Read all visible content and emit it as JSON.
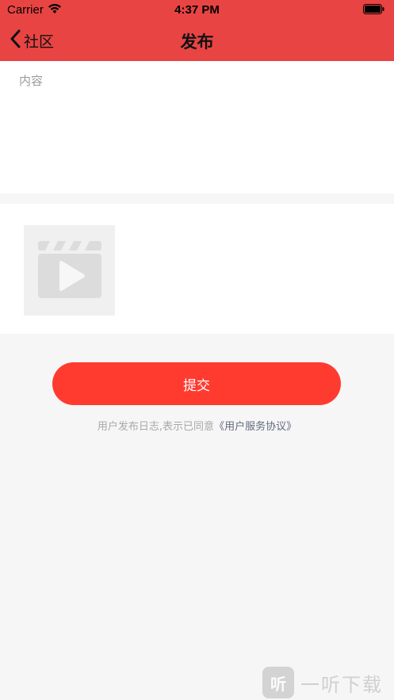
{
  "status_bar": {
    "carrier": "Carrier",
    "time": "4:37 PM",
    "wifi_icon": "wifi-icon",
    "battery_icon": "battery-icon"
  },
  "navbar": {
    "back_label": "社区",
    "title": "发布",
    "background_color": "#e84443"
  },
  "form": {
    "content_placeholder": "内容",
    "content_value": "",
    "video_icon": "video-clapperboard-icon"
  },
  "submit": {
    "label": "提交",
    "color": "#ff3b30"
  },
  "agreement": {
    "prefix": "用户发布日志,表示已同意",
    "link": "《用户服务协议》"
  },
  "watermark": {
    "logo": "听",
    "text": "一听下载"
  }
}
